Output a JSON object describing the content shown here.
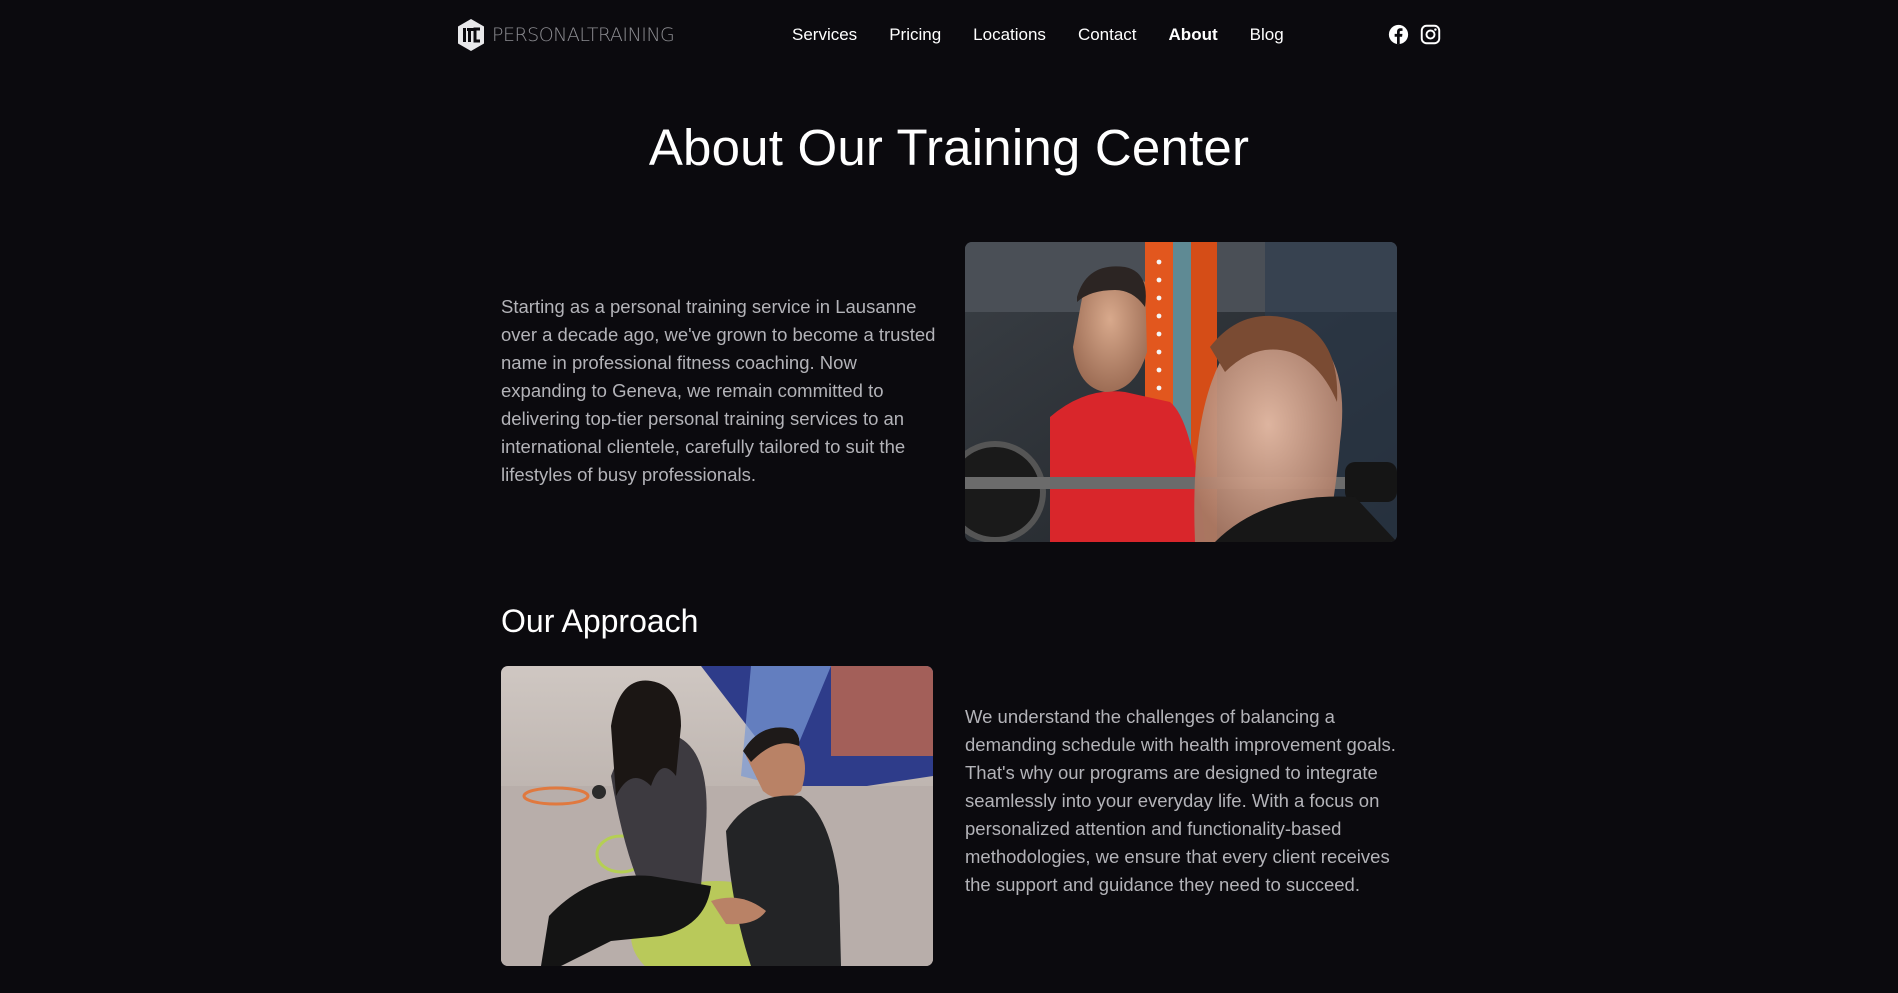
{
  "brand": {
    "logo_icon": "ltc-hexagon-logo-icon",
    "name": "PERSONALTRAINING"
  },
  "nav": {
    "items": [
      {
        "label": "Services",
        "active": false
      },
      {
        "label": "Pricing",
        "active": false
      },
      {
        "label": "Locations",
        "active": false
      },
      {
        "label": "Contact",
        "active": false
      },
      {
        "label": "About",
        "active": true
      },
      {
        "label": "Blog",
        "active": false
      }
    ]
  },
  "social": {
    "icons": [
      "facebook-icon",
      "instagram-icon"
    ]
  },
  "page": {
    "title": "About Our Training Center"
  },
  "intro": {
    "text": "Starting as a personal training service in Lausanne over a decade ago, we've grown to become a trusted name in professional fitness coaching. Now expanding to Geneva, we remain committed to delivering top-tier personal training services to an international clientele, carefully tailored to suit the lifestyles of busy professionals."
  },
  "approach": {
    "title": "Our Approach",
    "text": "We understand the challenges of balancing a demanding schedule with health improvement goals. That's why our programs are designed to integrate seamlessly into your everyday life. With a focus on personalized attention and functionality-based methodologies, we ensure that every client receives the support and guidance they need to succeed."
  },
  "colors": {
    "background": "#0b0a0e",
    "text": "#ffffff",
    "body_text": "#b3b3b8",
    "logo_text": "#8e8e93"
  }
}
